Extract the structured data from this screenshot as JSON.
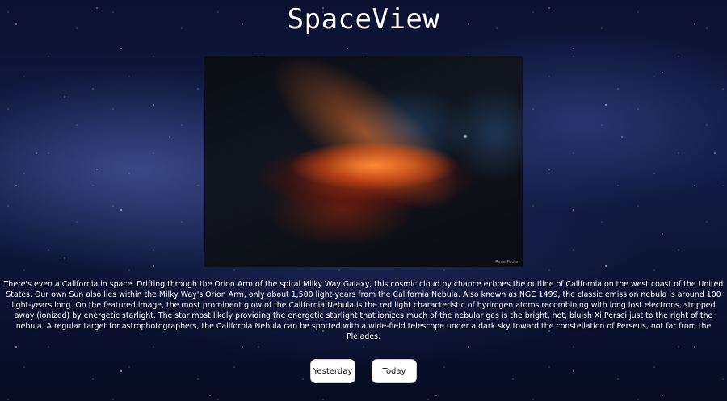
{
  "header": {
    "title": "SpaceView"
  },
  "apod": {
    "image_credit": "Rene Pedia",
    "description": "There's even a California in space. Drifting through the Orion Arm of the spiral Milky Way Galaxy, this cosmic cloud by chance echoes the outline of California on the west coast of the United States. Our own Sun also lies within the Milky Way's Orion Arm, only about 1,500 light-years from the California Nebula. Also known as NGC 1499, the classic emission nebula is around 100 light-years long. On the featured image, the most prominent glow of the California Nebula is the red light characteristic of hydrogen atoms recombining with long lost electrons, stripped away (ionized) by energetic starlight. The star most likely providing the energetic starlight that ionizes much of the nebular gas is the bright, hot, bluish Xi Persei just to the right of the nebula. A regular target for astrophotographers, the California Nebula can be spotted with a wide-field telescope under a dark sky toward the constellation of Perseus, not far from the Pleiades."
  },
  "navigation": {
    "yesterday_label": "Yesterday",
    "today_label": "Today"
  },
  "colors": {
    "background": "#0b1230",
    "text": "#ffffff",
    "button_background": "#ffffff",
    "button_text": "#111111"
  }
}
